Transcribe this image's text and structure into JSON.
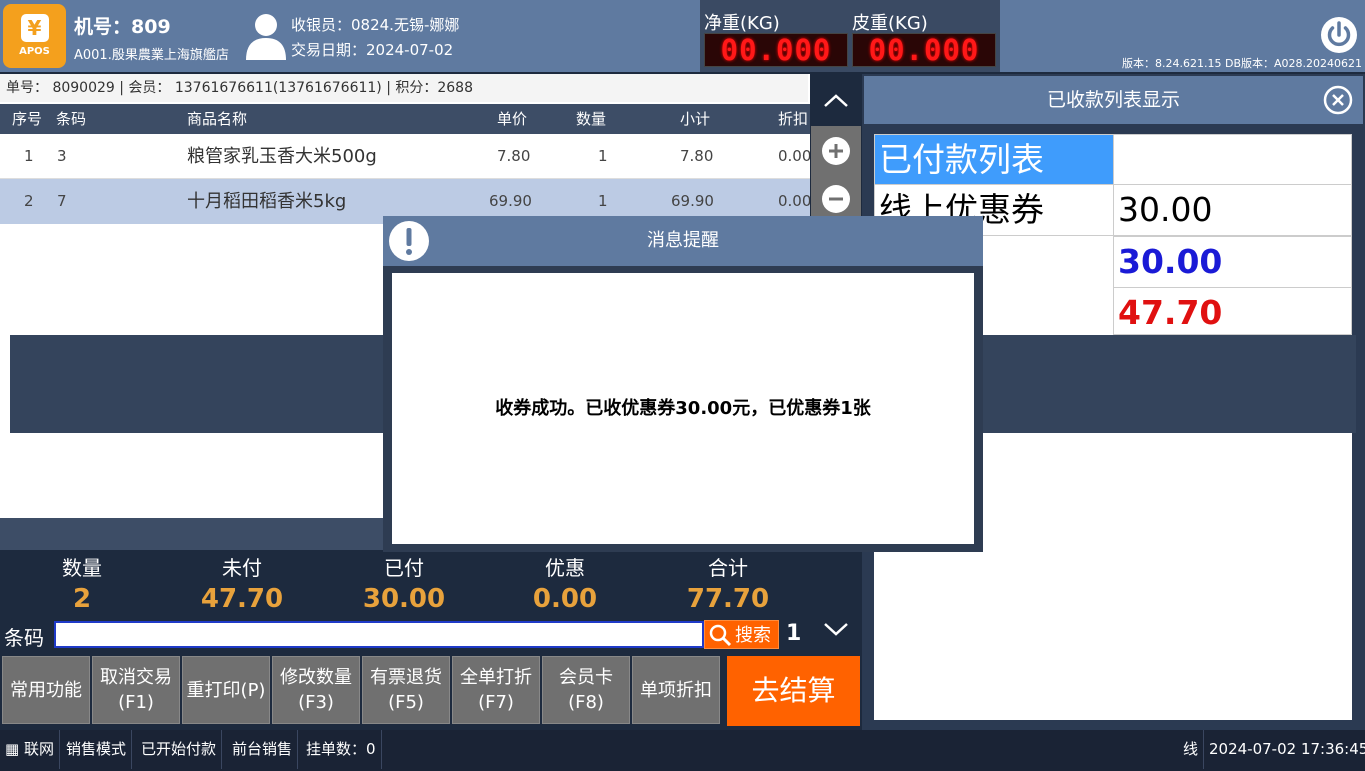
{
  "header": {
    "logo_text": "APOS",
    "logo_symbol": "¥",
    "machine": "机号：809",
    "store": "A001.殷果農業上海旗艦店",
    "cashier": "收银员：0824.无锡-娜娜",
    "trade_date": "交易日期：2024-07-02",
    "net_weight_label": "净重(KG)",
    "tare_weight_label": "皮重(KG)",
    "net_weight_value": "00.000",
    "tare_weight_value": "00.000",
    "version": "版本：8.24.621.15 DB版本：A028.20240621"
  },
  "order": {
    "info": "单号： 8090029   | 会员： 13761676611(13761676611) | 积分：2688"
  },
  "table": {
    "headers": {
      "seq": "序号",
      "code": "条码",
      "name": "商品名称",
      "price": "单价",
      "qty": "数量",
      "subtotal": "小计",
      "discount": "折扣"
    },
    "rows": [
      {
        "seq": "1",
        "code": "3",
        "name": "粮管家乳玉香大米500g",
        "price": "7.80",
        "qty": "1",
        "subtotal": "7.80",
        "discount": "0.00"
      },
      {
        "seq": "2",
        "code": "7",
        "name": "十月稻田稻香米5kg",
        "price": "69.90",
        "qty": "1",
        "subtotal": "69.90",
        "discount": "0.00"
      }
    ]
  },
  "totals": {
    "qty_label": "数量",
    "qty": "2",
    "unpaid_label": "未付",
    "unpaid": "47.70",
    "paid_label": "已付",
    "paid": "30.00",
    "discount_label": "优惠",
    "discount": "0.00",
    "total_label": "合计",
    "total": "77.70"
  },
  "barcode": {
    "label": "条码",
    "value": "",
    "search_label": "搜索",
    "page": "1"
  },
  "buttons": {
    "common": "常用功能",
    "cancel": "取消交易",
    "cancel_key": "(F1)",
    "reprint": "重打印(P)",
    "modify_qty": "修改数量",
    "modify_qty_key": "(F3)",
    "return": "有票退货",
    "return_key": "(F5)",
    "whole_discount": "全单打折",
    "whole_discount_key": "(F7)",
    "member": "会员卡",
    "member_key": "(F8)",
    "item_discount": "单项折扣",
    "checkout": "去结算"
  },
  "panel": {
    "title": "已收款列表显示",
    "list_title": "已付款列表",
    "coupon_label": "线上优惠券",
    "coupon_value": "30.00",
    "paid_value": "30.00",
    "unpaid_value": "47.70"
  },
  "dialog": {
    "title": "消息提醒",
    "message": "收券成功。已收优惠券30.00元，已优惠券1张"
  },
  "status": {
    "network": "联网",
    "mode": "销售模式",
    "payment": "已开始付款",
    "counter": "前台销售",
    "hold_count": "挂单数：0",
    "line_char": "线",
    "datetime": "2024-07-02 17:36:45"
  },
  "colors": {
    "accent": "#ff6200",
    "header_bg": "#5f7aa0",
    "paid_blue": "#1a1ad6",
    "unpaid_red": "#e01010",
    "total_gold": "#e8a23c"
  }
}
